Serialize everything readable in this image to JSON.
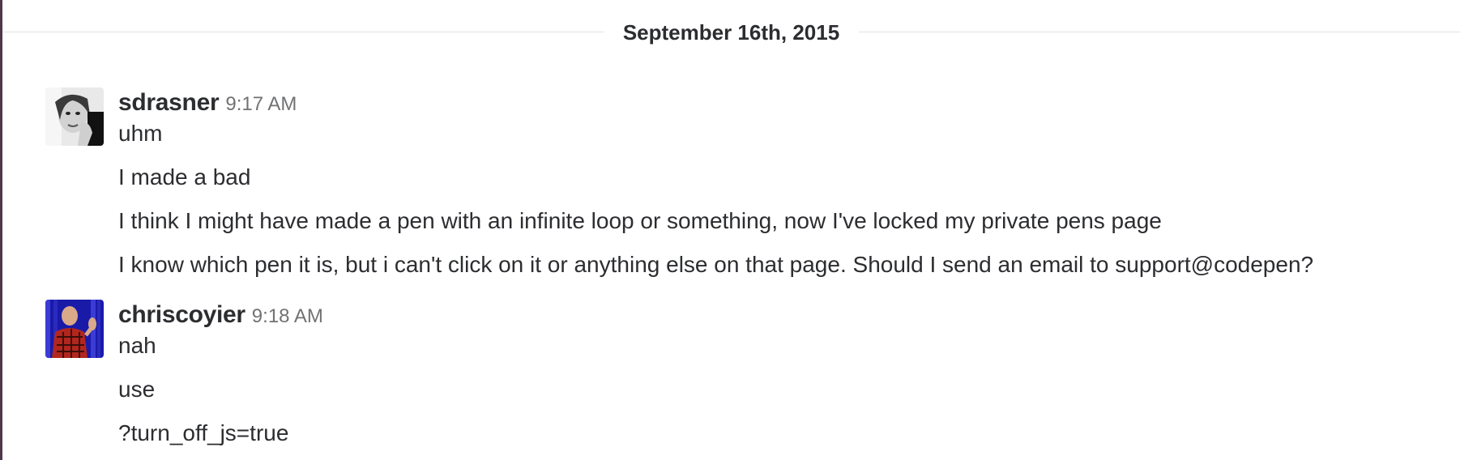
{
  "day_divider": {
    "label": "September 16th, 2015"
  },
  "messages": [
    {
      "username": "sdrasner",
      "time": "9:17 AM",
      "lines": [
        "uhm",
        "I made a bad",
        "I think I might have made a pen with an infinite loop or something, now I've locked my private pens page",
        "I know which pen it is, but i can't click on it or anything else on that page. Should I send an email to support@codepen?"
      ]
    },
    {
      "username": "chriscoyier",
      "time": "9:18 AM",
      "lines": [
        "nah",
        "use",
        "?turn_off_js=true"
      ]
    }
  ],
  "colors": {
    "sidebar_edge": "#4d394b",
    "text": "#2c2d30",
    "timestamp": "#717274",
    "divider_rule": "#e1e1e1"
  }
}
